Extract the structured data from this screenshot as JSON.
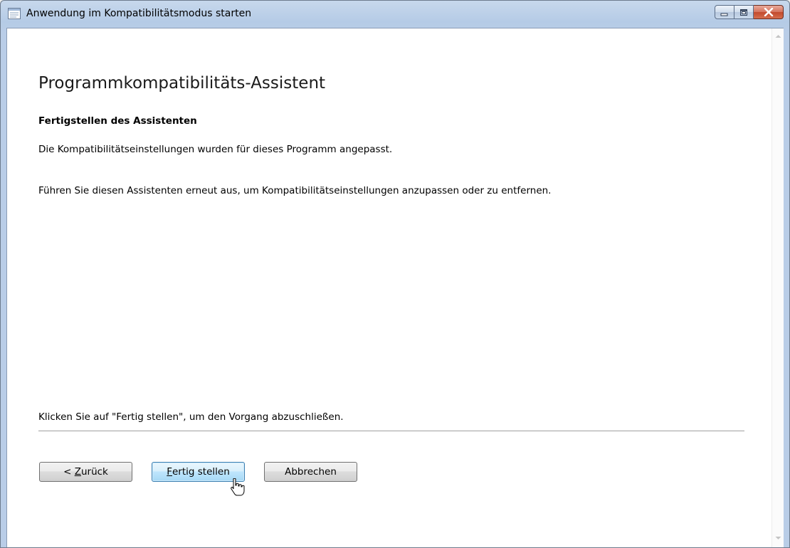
{
  "window": {
    "title": "Anwendung im Kompatibilitätsmodus starten",
    "icon": "window-app-icon",
    "controls": {
      "minimize": "minimize-icon",
      "maximize": "maximize-icon",
      "close": "close-icon"
    }
  },
  "wizard": {
    "heading": "Programmkompatibilitäts-Assistent",
    "subheading": "Fertigstellen des Assistenten",
    "text1": "Die Kompatibilitätseinstellungen wurden für dieses Programm angepasst.",
    "text2": "Führen Sie diesen Assistenten erneut aus, um Kompatibilitätseinstellungen anzupassen oder zu entfernen.",
    "footer_text": "Klicken Sie auf \"Fertig stellen\", um den Vorgang abzuschließen."
  },
  "buttons": {
    "back": {
      "prefix": "< ",
      "accel": "Z",
      "rest": "urück"
    },
    "finish": {
      "prefix": "",
      "accel": "F",
      "rest": "ertig stellen"
    },
    "cancel": {
      "label": "Abbrechen"
    }
  },
  "colors": {
    "title_gradient_top": "#c7d8ec",
    "title_gradient_bottom": "#b9cde7",
    "close_button": "#c24a2d",
    "default_button_border": "#3c7fb1",
    "content_background": "#ffffff"
  }
}
